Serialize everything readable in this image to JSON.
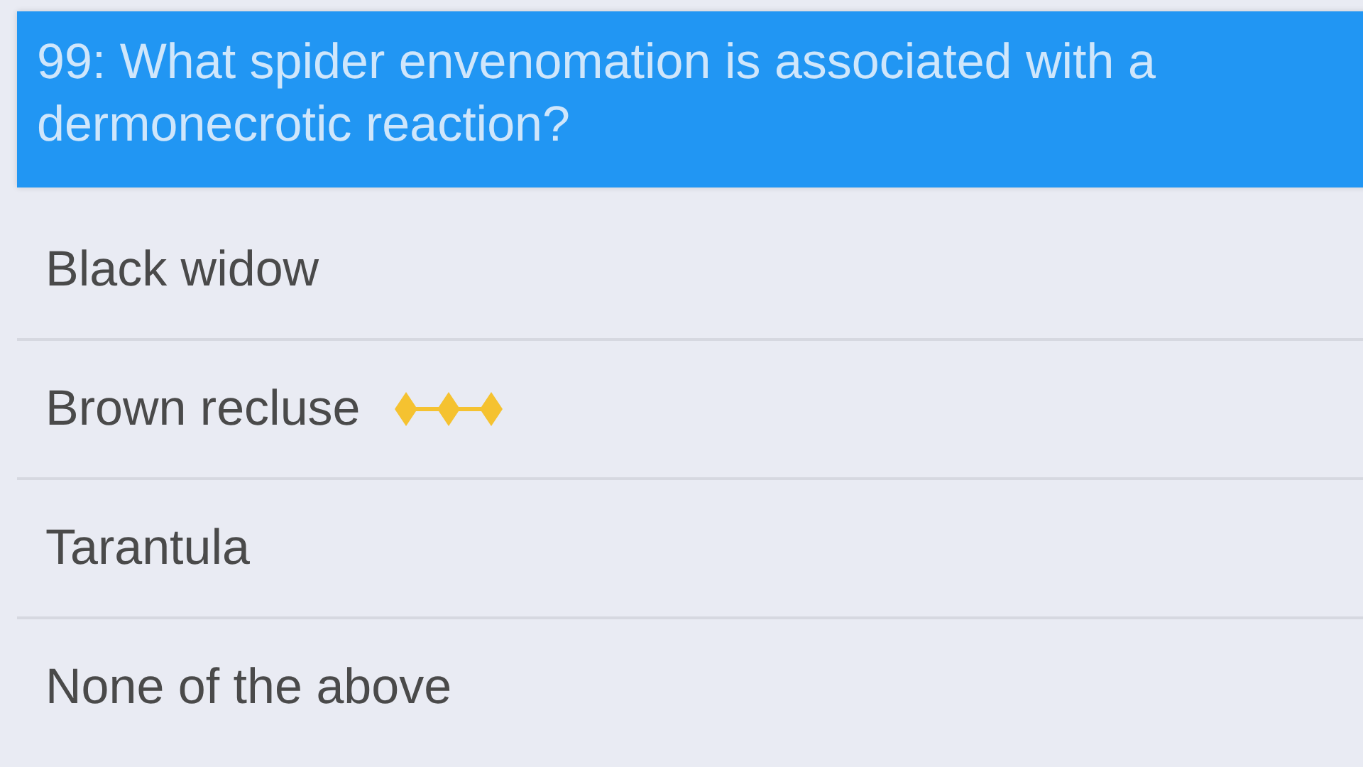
{
  "question": {
    "text": "99: What spider envenomation is associated with a dermonecrotic reaction?"
  },
  "options": [
    {
      "label": "Black widow",
      "correct": false
    },
    {
      "label": "Brown recluse",
      "correct": true
    },
    {
      "label": "Tarantula",
      "correct": false
    },
    {
      "label": "None of the above",
      "correct": false
    }
  ]
}
